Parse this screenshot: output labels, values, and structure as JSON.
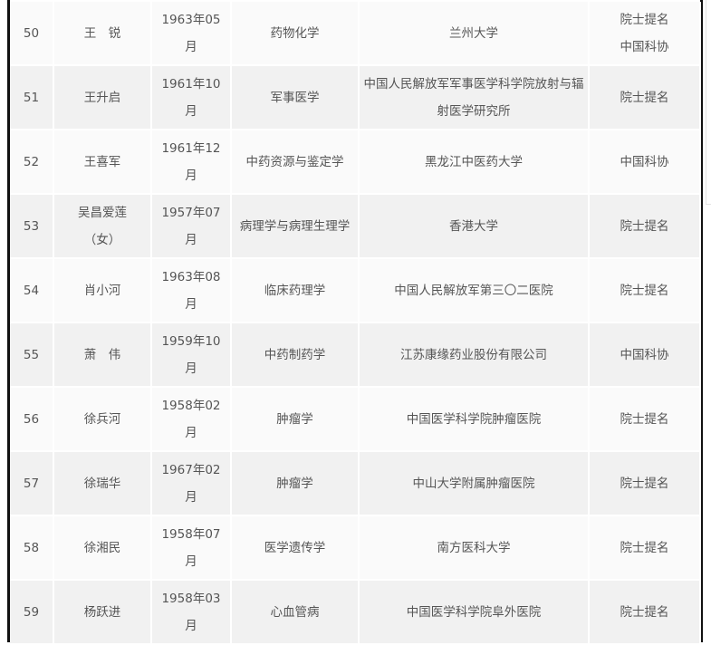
{
  "table": {
    "rows": [
      {
        "no": "50",
        "name": "王　锐",
        "birth": "1963年05月",
        "field": "药物化学",
        "org": "兰州大学",
        "source": "院士提名\n中国科协"
      },
      {
        "no": "51",
        "name": "王升启",
        "birth": "1961年10月",
        "field": "军事医学",
        "org": "中国人民解放军军事医学科学院放射与辐射医学研究所",
        "source": "院士提名"
      },
      {
        "no": "52",
        "name": "王喜军",
        "birth": "1961年12月",
        "field": "中药资源与鉴定学",
        "org": "黑龙江中医药大学",
        "source": "中国科协"
      },
      {
        "no": "53",
        "name": "吴昌爱莲（女）",
        "birth": "1957年07月",
        "field": "病理学与病理生理学",
        "org": "香港大学",
        "source": "院士提名"
      },
      {
        "no": "54",
        "name": "肖小河",
        "birth": "1963年08月",
        "field": "临床药理学",
        "org": "中国人民解放军第三〇二医院",
        "source": "院士提名"
      },
      {
        "no": "55",
        "name": "萧　伟",
        "birth": "1959年10月",
        "field": "中药制药学",
        "org": "江苏康缘药业股份有限公司",
        "source": "中国科协"
      },
      {
        "no": "56",
        "name": "徐兵河",
        "birth": "1958年02月",
        "field": "肿瘤学",
        "org": "中国医学科学院肿瘤医院",
        "source": "院士提名"
      },
      {
        "no": "57",
        "name": "徐瑞华",
        "birth": "1967年02月",
        "field": "肿瘤学",
        "org": "中山大学附属肿瘤医院",
        "source": "院士提名"
      },
      {
        "no": "58",
        "name": "徐湘民",
        "birth": "1958年07月",
        "field": "医学遗传学",
        "org": "南方医科大学",
        "source": "院士提名"
      },
      {
        "no": "59",
        "name": "杨跃进",
        "birth": "1958年03月",
        "field": "心血管病",
        "org": "中国医学科学院阜外医院",
        "source": "院士提名"
      }
    ]
  }
}
